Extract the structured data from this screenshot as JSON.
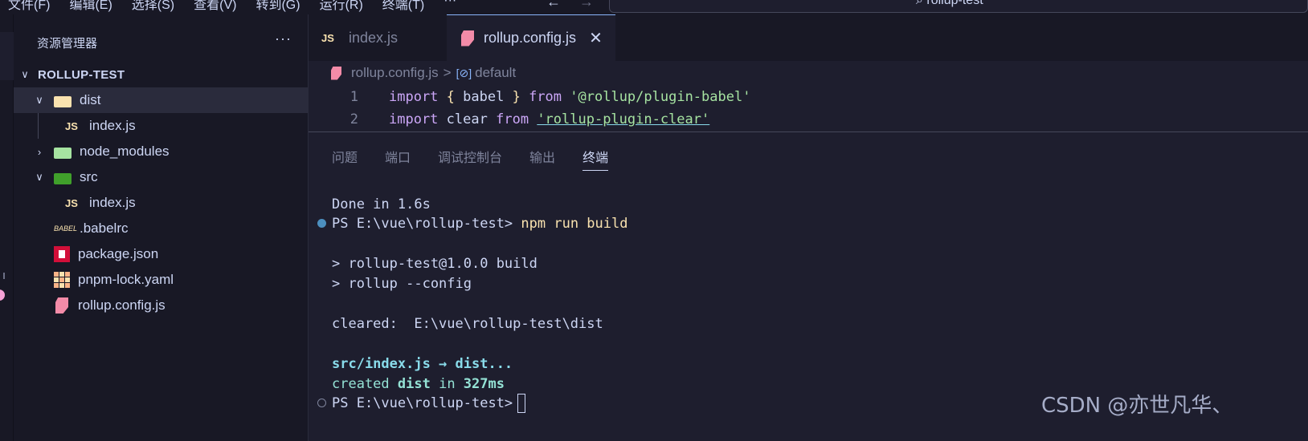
{
  "menubar": {
    "items": [
      "文件(F)",
      "编辑(E)",
      "选择(S)",
      "查看(V)",
      "转到(G)",
      "运行(R)",
      "终端(T)",
      "···"
    ],
    "back": "←",
    "forward": "→",
    "search_text": "⌕ rollup-test"
  },
  "sidebar": {
    "title": "资源管理器",
    "more": "···",
    "root": "ROLLUP-TEST",
    "items": [
      {
        "label": "dist",
        "kind": "folder"
      },
      {
        "label": "index.js",
        "kind": "js"
      },
      {
        "label": "node_modules",
        "kind": "folder"
      },
      {
        "label": "src",
        "kind": "folder"
      },
      {
        "label": "index.js",
        "kind": "js"
      },
      {
        "label": ".babelrc",
        "kind": "babel"
      },
      {
        "label": "package.json",
        "kind": "npm"
      },
      {
        "label": "pnpm-lock.yaml",
        "kind": "pnpm"
      },
      {
        "label": "rollup.config.js",
        "kind": "rollup"
      }
    ],
    "js_glyph": "JS",
    "babel_glyph": "BABEL"
  },
  "tabs": [
    {
      "label": "index.js",
      "icon": "JS"
    },
    {
      "label": "rollup.config.js",
      "close": "✕"
    }
  ],
  "breadcrumb": {
    "file": "rollup.config.js",
    "sep": ">",
    "symbol_icon": "[⊘]",
    "symbol": "default"
  },
  "code": {
    "lines": [
      {
        "n": "1",
        "kw1": "import",
        "b1": "{",
        "id": " babel ",
        "b2": "}",
        "kw2": "from",
        "str": "'@rollup/plugin-babel'"
      },
      {
        "n": "2",
        "kw1": "import",
        "id": "clear",
        "kw2": "from",
        "str": "'rollup-plugin-clear'"
      }
    ]
  },
  "panel": {
    "tabs": [
      "问题",
      "端口",
      "调试控制台",
      "输出",
      "终端"
    ],
    "active_tab": "终端"
  },
  "terminal": {
    "done": "Done in 1.6s",
    "prompt": "PS E:\\vue\\rollup-test>",
    "command": "npm run build",
    "out1": "> rollup-test@1.0.0 build",
    "out2": "> rollup --config",
    "cleared": "cleared:  E:\\vue\\rollup-test\\dist",
    "bundle": "src/index.js → dist...",
    "created_prefix": "created ",
    "created_dist": "dist",
    "created_in": " in ",
    "created_time": "327ms",
    "prompt2": "PS E:\\vue\\rollup-test>"
  },
  "watermark": "CSDN @亦世凡华、"
}
